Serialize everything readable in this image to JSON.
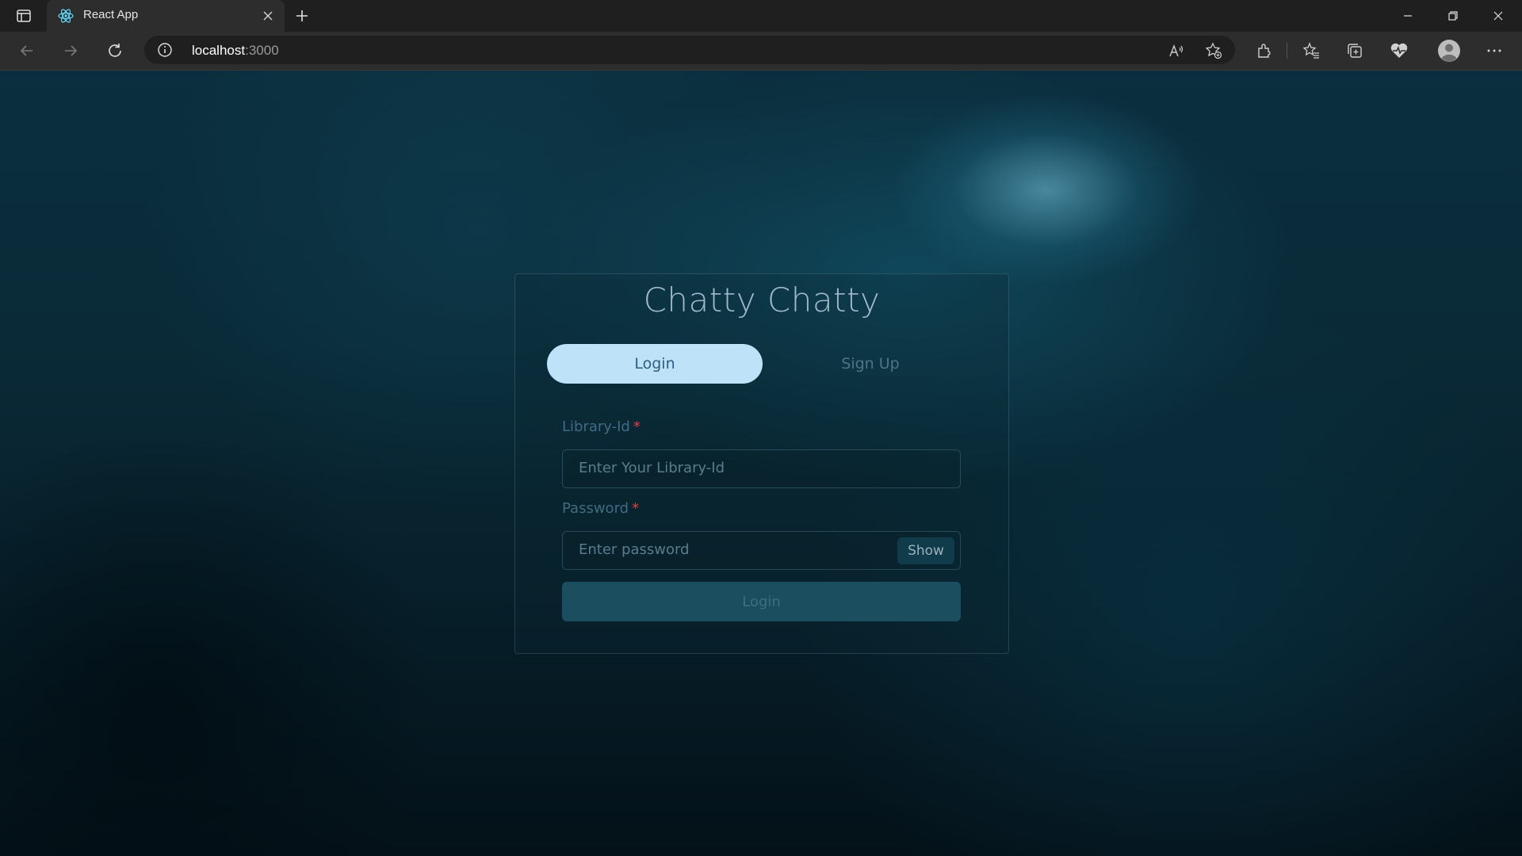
{
  "browser": {
    "tab_title": "React App",
    "address_host": "localhost",
    "address_port": ":3000"
  },
  "app": {
    "title": "Chatty Chatty",
    "tabs": {
      "login": "Login",
      "signup": "Sign Up"
    },
    "form": {
      "library_label": "Library-Id",
      "library_placeholder": "Enter Your Library-Id",
      "password_label": "Password",
      "password_placeholder": "Enter password",
      "required_mark": "*",
      "show_label": "Show",
      "submit_label": "Login"
    }
  },
  "colors": {
    "accent_tab": "#bee3f8",
    "required": "#e53e3e",
    "submit_bg": "#1b4e5e"
  },
  "icons": [
    "sidebar-icon",
    "react-favicon-icon",
    "close-icon",
    "plus-icon",
    "minimize-icon",
    "restore-icon",
    "back-icon",
    "forward-icon",
    "refresh-icon",
    "info-icon",
    "read-aloud-icon",
    "favorite-add-icon",
    "extensions-icon",
    "favorites-icon",
    "collections-icon",
    "health-icon",
    "profile-icon",
    "more-icon"
  ]
}
